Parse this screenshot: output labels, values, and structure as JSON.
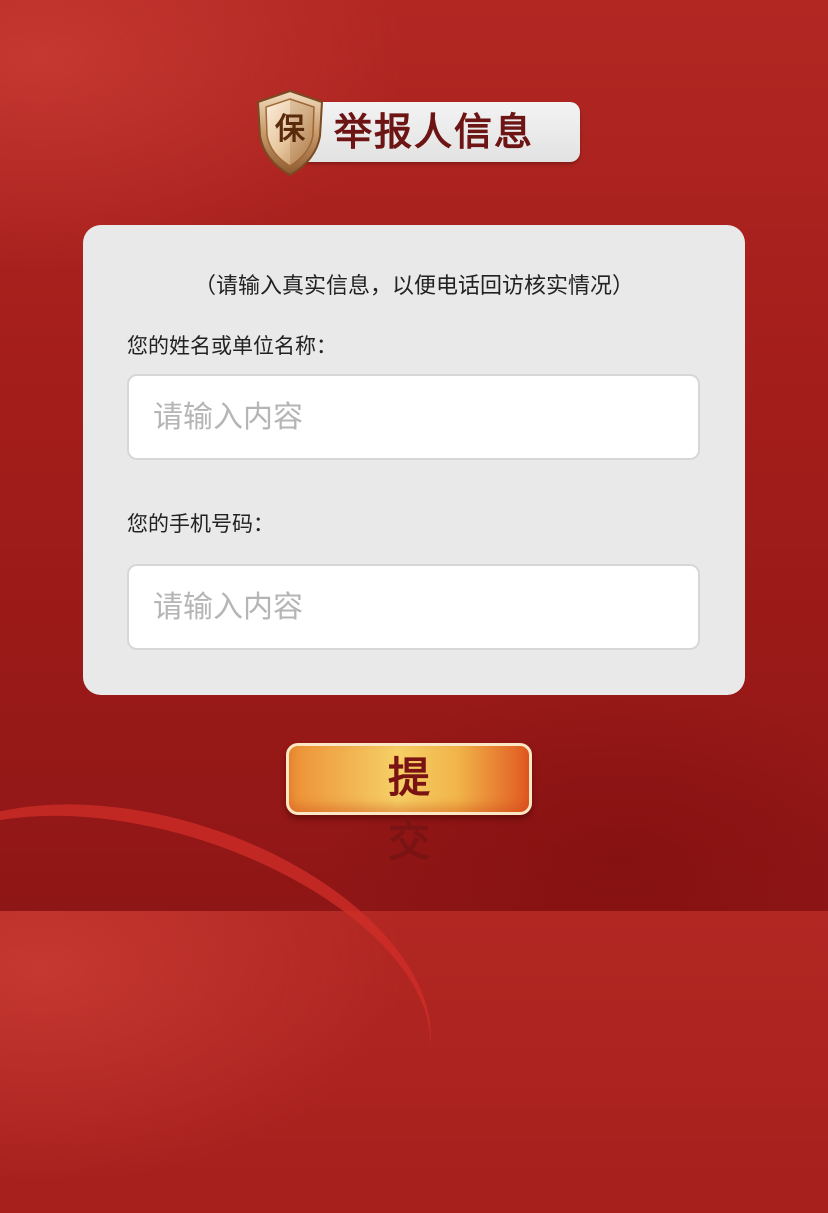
{
  "header": {
    "badge_char": "保",
    "title": "举报人信息"
  },
  "form": {
    "hint": "（请输入真实信息，以便电话回访核实情况）",
    "name_field": {
      "label": "您的姓名或单位名称：",
      "placeholder": "请输入内容",
      "value": ""
    },
    "phone_field": {
      "label": "您的手机号码：",
      "placeholder": "请输入内容",
      "value": ""
    }
  },
  "submit": {
    "label": "提交"
  },
  "colors": {
    "background": "#a61f1c",
    "card": "#e9e9e9",
    "title_text": "#6d1414",
    "button_gold": "#f6d066",
    "button_orange": "#e15a22"
  }
}
